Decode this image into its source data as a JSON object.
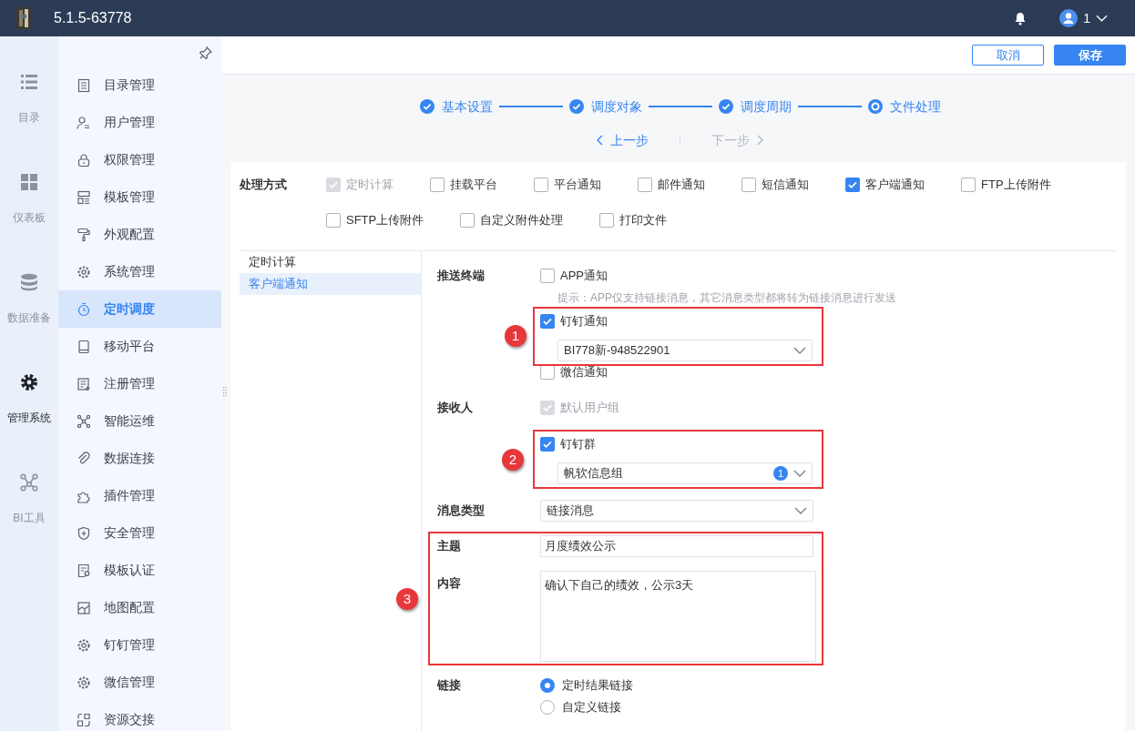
{
  "header": {
    "version": "5.1.5-63778",
    "user": "1"
  },
  "rail": [
    {
      "label": "目录",
      "selected": false
    },
    {
      "label": "仪表板",
      "selected": false
    },
    {
      "label": "数据准备",
      "selected": false
    },
    {
      "label": "管理系统",
      "selected": true
    },
    {
      "label": "BI工具",
      "selected": false
    }
  ],
  "menu": [
    {
      "label": "目录管理",
      "selected": false
    },
    {
      "label": "用户管理",
      "selected": false
    },
    {
      "label": "权限管理",
      "selected": false
    },
    {
      "label": "模板管理",
      "selected": false
    },
    {
      "label": "外观配置",
      "selected": false
    },
    {
      "label": "系统管理",
      "selected": false
    },
    {
      "label": "定时调度",
      "selected": true
    },
    {
      "label": "移动平台",
      "selected": false
    },
    {
      "label": "注册管理",
      "selected": false
    },
    {
      "label": "智能运维",
      "selected": false
    },
    {
      "label": "数据连接",
      "selected": false
    },
    {
      "label": "插件管理",
      "selected": false
    },
    {
      "label": "安全管理",
      "selected": false
    },
    {
      "label": "模板认证",
      "selected": false
    },
    {
      "label": "地图配置",
      "selected": false
    },
    {
      "label": "钉钉管理",
      "selected": false
    },
    {
      "label": "微信管理",
      "selected": false
    },
    {
      "label": "资源交接",
      "selected": false
    }
  ],
  "toolbar": {
    "buttons": [
      {
        "label": "取消",
        "kind": "secondary"
      },
      {
        "label": "保存",
        "kind": "primary"
      }
    ]
  },
  "steps": [
    {
      "label": "基本设置",
      "completed": true,
      "current": false
    },
    {
      "label": "调度对象",
      "completed": true,
      "current": false
    },
    {
      "label": "调度周期",
      "completed": true,
      "current": false
    },
    {
      "label": "文件处理",
      "completed": false,
      "current": true
    }
  ],
  "step_nav": [
    {
      "label": "上一步",
      "disabled": false,
      "kind": "prev"
    },
    {
      "label": "下一步",
      "disabled": true,
      "kind": "next"
    }
  ],
  "methods": {
    "label": "处理方式",
    "options": [
      {
        "label": "定时计算",
        "checked": true,
        "disabled": true
      },
      {
        "label": "挂载平台",
        "checked": false,
        "disabled": false
      },
      {
        "label": "平台通知",
        "checked": false,
        "disabled": false
      },
      {
        "label": "邮件通知",
        "checked": false,
        "disabled": false
      },
      {
        "label": "短信通知",
        "checked": false,
        "disabled": false
      },
      {
        "label": "客户端通知",
        "checked": true,
        "disabled": false
      },
      {
        "label": "FTP上传附件",
        "checked": false,
        "disabled": false
      },
      {
        "label": "SFTP上传附件",
        "checked": false,
        "disabled": false
      },
      {
        "label": "自定义附件处理",
        "checked": false,
        "disabled": false
      },
      {
        "label": "打印文件",
        "checked": false,
        "disabled": false
      }
    ]
  },
  "sub_tabs": [
    {
      "label": "定时计算",
      "selected": false
    },
    {
      "label": "客户端通知",
      "selected": true
    }
  ],
  "push": {
    "label": "推送终端",
    "app": {
      "label": "APP通知",
      "checked": false
    },
    "hint": "提示：APP仅支持链接消息，其它消息类型都将转为链接消息进行发送",
    "dingtalk": {
      "label": "钉钉通知",
      "checked": true,
      "select": "BI778新-948522901"
    },
    "wechat": {
      "label": "微信通知",
      "checked": false
    }
  },
  "receiver": {
    "label": "接收人",
    "default": {
      "label": "默认用户组",
      "checked": true,
      "disabled": true
    },
    "group": {
      "label": "钉钉群",
      "checked": true,
      "select": "帆软信息组",
      "count": "1"
    }
  },
  "msg_type": {
    "label": "消息类型",
    "value": "链接消息"
  },
  "subject": {
    "label": "主题",
    "value": "月度绩效公示"
  },
  "content": {
    "label": "内容",
    "value": "确认下自己的绩效，公示3天"
  },
  "link": {
    "label": "链接",
    "options": [
      {
        "label": "定时结果链接",
        "selected": true
      },
      {
        "label": "自定义链接",
        "selected": false
      }
    ]
  },
  "annotations": [
    "1",
    "2",
    "3"
  ]
}
